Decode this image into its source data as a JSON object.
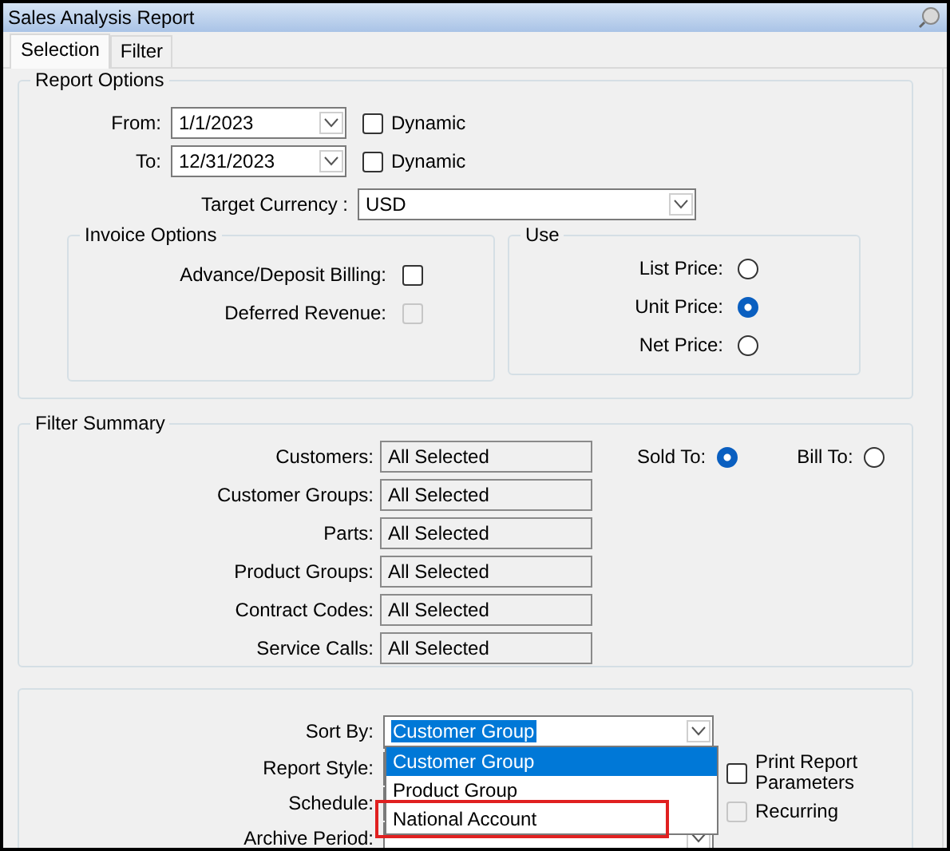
{
  "window": {
    "title": "Sales Analysis Report"
  },
  "tabs": [
    {
      "label": "Selection",
      "selected": true
    },
    {
      "label": "Filter",
      "selected": false
    }
  ],
  "report_options": {
    "title": "Report Options",
    "dates": [
      {
        "label": "From:",
        "value": "1/1/2023",
        "dynamic": {
          "label": "Dynamic",
          "checked": false
        }
      },
      {
        "label": "To:",
        "value": "12/31/2023",
        "dynamic": {
          "label": "Dynamic",
          "checked": false
        }
      }
    ],
    "target_currency": {
      "label": "Target Currency :",
      "value": "USD"
    },
    "invoice_options": {
      "title": "Invoice Options",
      "items": [
        {
          "label": "Advance/Deposit Billing:",
          "checked": false,
          "disabled": false
        },
        {
          "label": "Deferred Revenue:",
          "checked": false,
          "disabled": true
        }
      ]
    },
    "use": {
      "title": "Use",
      "options": [
        {
          "label": "List Price:",
          "selected": false
        },
        {
          "label": "Unit Price:",
          "selected": true
        },
        {
          "label": "Net Price:",
          "selected": false
        }
      ]
    }
  },
  "filter_summary": {
    "title": "Filter Summary",
    "rows": [
      {
        "label": "Customers:",
        "value": "All Selected"
      },
      {
        "label": "Customer Groups:",
        "value": "All Selected"
      },
      {
        "label": "Parts:",
        "value": "All Selected"
      },
      {
        "label": "Product Groups:",
        "value": "All Selected"
      },
      {
        "label": "Contract Codes:",
        "value": "All Selected"
      },
      {
        "label": "Service Calls:",
        "value": "All Selected"
      }
    ],
    "customer_type": [
      {
        "label": "Sold To:",
        "selected": true
      },
      {
        "label": "Bill To:",
        "selected": false
      }
    ]
  },
  "output": {
    "sort_by": {
      "label": "Sort By:",
      "value": "Customer Group",
      "open": true
    },
    "sort_options": [
      {
        "label": "Customer Group",
        "selected": true,
        "highlighted": false
      },
      {
        "label": "Product Group",
        "selected": false,
        "highlighted": false
      },
      {
        "label": "National Account",
        "selected": false,
        "highlighted": true
      }
    ],
    "report_style": {
      "label": "Report Style:"
    },
    "schedule": {
      "label": "Schedule:"
    },
    "archive_period": {
      "label": "Archive Period:"
    },
    "checks": [
      {
        "label": "Print Report Parameters",
        "checked": false,
        "disabled": false
      },
      {
        "label": "Recurring",
        "checked": false,
        "disabled": true
      }
    ]
  }
}
